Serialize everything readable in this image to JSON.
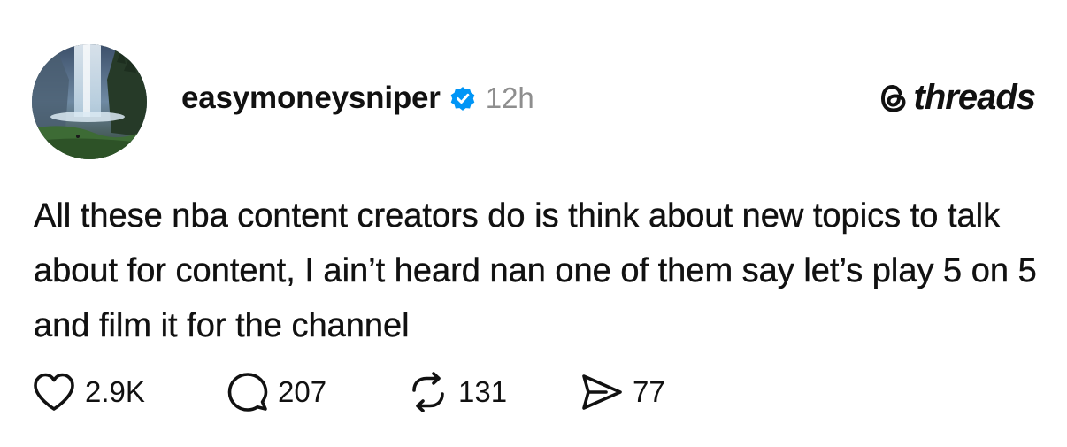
{
  "post": {
    "username": "easymoneysniper",
    "verified": true,
    "timestamp": "12h",
    "text": "All these nba content creators do is think about new topics to talk about for content, I ain’t heard nan one of them say let’s play 5 on 5 and film it for the channel"
  },
  "brand": {
    "name": "threads"
  },
  "actions": {
    "likes": "2.9K",
    "replies": "207",
    "reposts": "131",
    "shares": "77"
  },
  "colors": {
    "text": "#111111",
    "muted": "#8e8e8e",
    "verified_badge": "#0095f6",
    "background": "#ffffff"
  },
  "icons": [
    "heart-icon",
    "comment-icon",
    "repost-icon",
    "share-icon",
    "verified-icon",
    "threads-logo-icon"
  ]
}
